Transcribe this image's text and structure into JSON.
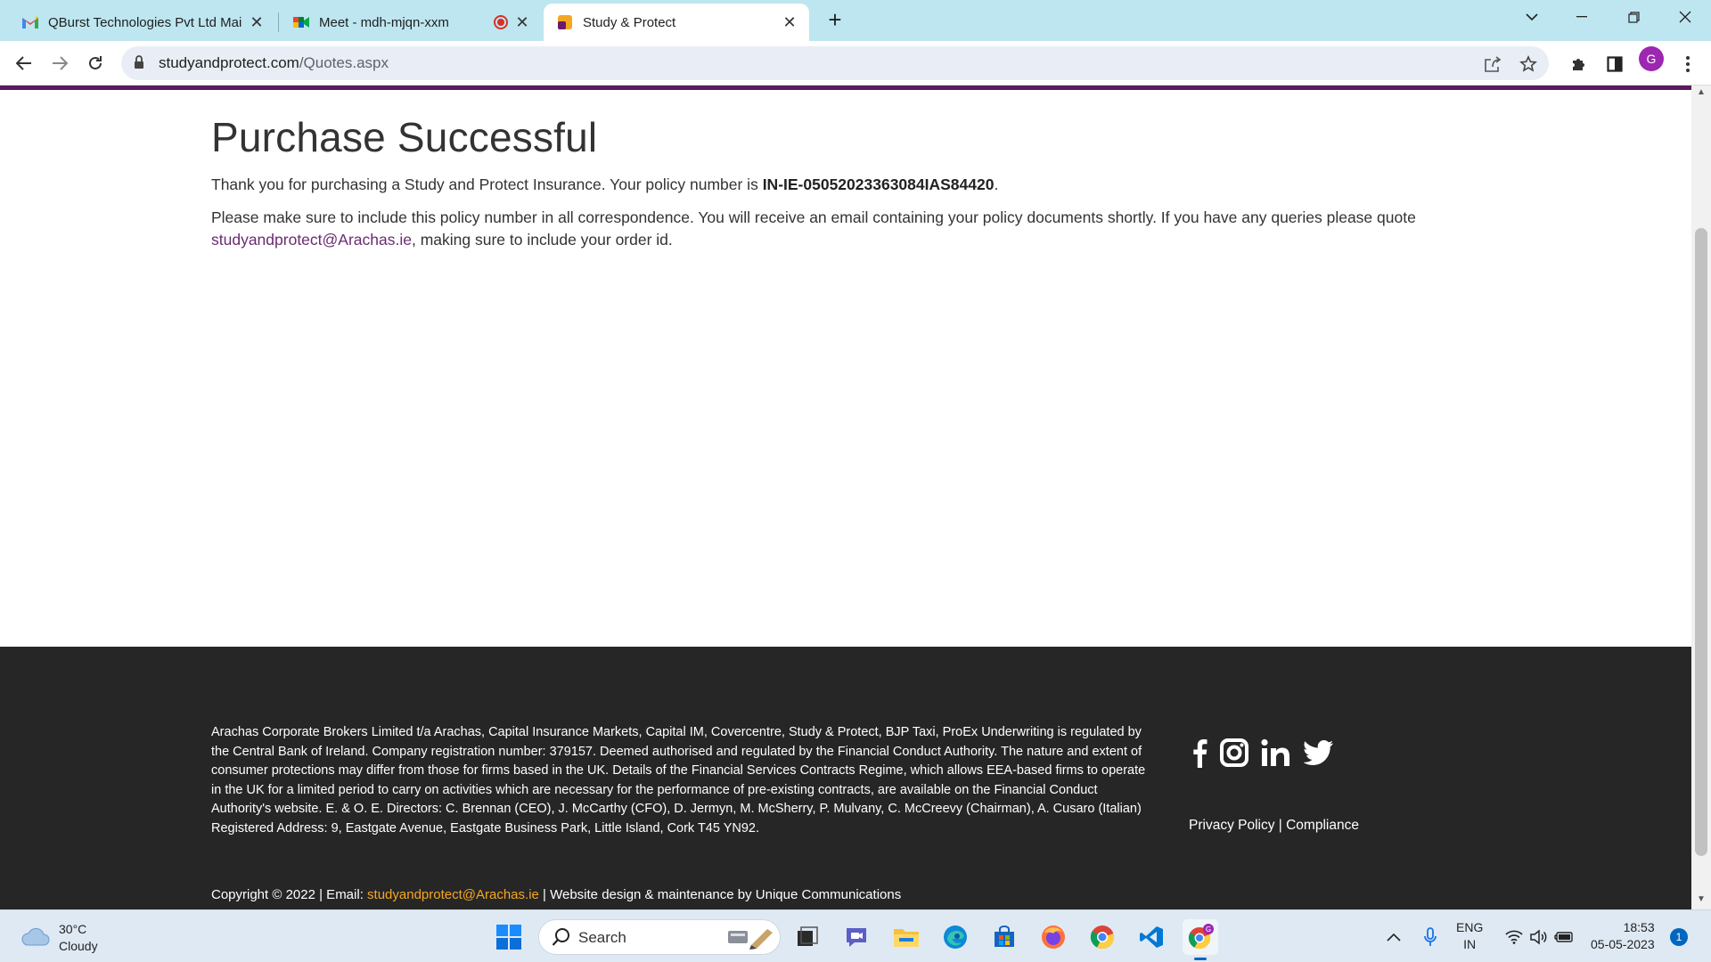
{
  "browser": {
    "tabs": [
      {
        "title": "QBurst Technologies Pvt Ltd Mail",
        "icon": "gmail-icon"
      },
      {
        "title": "Meet - mdh-mjqn-xxm",
        "icon": "meet-icon",
        "recording": true
      },
      {
        "title": "Study & Protect",
        "icon": "site-icon",
        "active": true
      }
    ],
    "new_tab_glyph": "+",
    "url_host": "studyandprotect.com",
    "url_path": "/Quotes.aspx",
    "profile_initial": "G"
  },
  "page": {
    "heading": "Purchase Successful",
    "para1_text": "Thank you for purchasing a Study and Protect Insurance. Your policy number is ",
    "policy_number": "IN-IE-05052023363084IAS84420",
    "para1_end": ".",
    "para2_text": "Please make sure to include this policy number in all correspondence. You will receive an email containing your policy documents shortly. If you have any queries please quote ",
    "contact_email": "studyandprotect@Arachas.ie",
    "para2_end": ", making sure to include your order id."
  },
  "footer": {
    "legal_text": "Arachas Corporate Brokers Limited t/a Arachas, Capital Insurance Markets, Capital IM, Covercentre, Study & Protect, BJP Taxi, ProEx Underwriting is regulated by the Central Bank of Ireland. Company registration number: 379157. Deemed authorised and regulated by the Financial Conduct Authority. The nature and extent of consumer protections may differ from those for firms based in the UK. Details of the Financial Services Contracts Regime, which allows EEA-based firms to operate in the UK for a limited period to carry on activities which are necessary for the performance of pre-existing contracts, are available on the Financial Conduct Authority's website. E. & O. E. Directors: C. Brennan (CEO), J. McCarthy (CFO), D. Jermyn, M. McSherry, P. Mulvany, C. McCreevy (Chairman), A. Cusaro (Italian)",
    "address": "Registered Address: 9, Eastgate Avenue, Eastgate Business Park, Little Island, Cork T45 YN92.",
    "copyright_prefix": "Copyright © 2022 | Email: ",
    "copyright_email": "studyandprotect@Arachas.ie",
    "copyright_suffix": " | Website design & maintenance by Unique Communications",
    "privacy_label": "Privacy Policy",
    "separator": " | ",
    "compliance_label": "Compliance",
    "social": [
      "facebook-icon",
      "instagram-icon",
      "linkedin-icon",
      "twitter-icon"
    ]
  },
  "taskbar": {
    "weather_temp": "30°C",
    "weather_desc": "Cloudy",
    "search_placeholder": "Search",
    "lang_line1": "ENG",
    "lang_line2": "IN",
    "time": "18:53",
    "date": "05-05-2023",
    "notification_count": "1"
  },
  "colors": {
    "accent_purple": "#5a1a5e",
    "link_purple": "#6a2c70",
    "footer_bg": "#262626",
    "footer_link": "#f5a623",
    "tabstrip": "#bde6f0"
  }
}
